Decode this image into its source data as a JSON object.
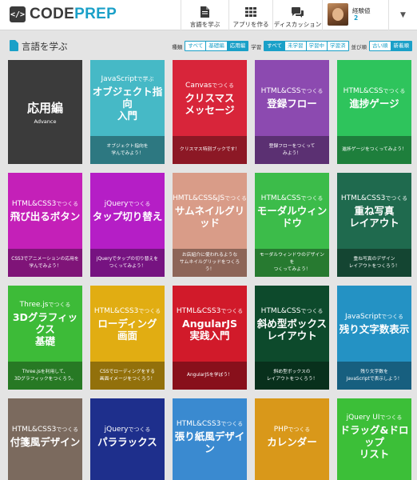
{
  "header": {
    "logo": {
      "icon": "code-icon",
      "glyph": "</>",
      "part1": "CODE",
      "part2": "PREP"
    },
    "nav": [
      {
        "label": "言語を学ぶ",
        "icon": "document-icon"
      },
      {
        "label": "アプリを作る",
        "icon": "grid-icon"
      },
      {
        "label": "ディスカッション",
        "icon": "chat-icon"
      }
    ],
    "user": {
      "name": "経験値",
      "level": "2",
      "caret": "▼"
    }
  },
  "page": {
    "title": "言語を学ぶ",
    "filters": {
      "kind_label": "種類",
      "kind_options": [
        "すべて",
        "基礎編",
        "応用編"
      ],
      "status_label": "学習",
      "status_options": [
        "すべて",
        "未学習",
        "学習中",
        "学習済"
      ],
      "sort_label": "並び順",
      "sort_options": [
        "古い順",
        "新着順"
      ]
    }
  },
  "colors": {
    "accent": "#1aa0c8"
  },
  "cards": [
    {
      "tech": "",
      "tech_suffix": "",
      "title": "応用編",
      "sub": "Advance",
      "desc": "",
      "color": "#3b3b3b"
    },
    {
      "tech": "JavaScript",
      "tech_suffix": "で学ぶ",
      "title": "オブジェクト指向\n入門",
      "sub": "",
      "desc": "オブジェクト指向を\n学んでみよう！",
      "color": "#46b9c6"
    },
    {
      "tech": "Canvas",
      "tech_suffix": "でつくる",
      "title": "クリスマス\nメッセージ",
      "sub": "",
      "desc": "クリスマス特別ブックです！",
      "color": "#d8253a"
    },
    {
      "tech": "HTML&CSS",
      "tech_suffix": "でつくる",
      "title": "登録フロー",
      "sub": "",
      "desc": "登録フローをつくって\nみよう！",
      "color": "#8c4ab0"
    },
    {
      "tech": "HTML&CSS",
      "tech_suffix": "でつくる",
      "title": "進捗ゲージ",
      "sub": "",
      "desc": "進捗ゲージをつくってみよう！",
      "color": "#2ec45c"
    },
    {
      "tech": "HTML&CSS3",
      "tech_suffix": "でつくる",
      "title": "飛び出るボタン",
      "sub": "",
      "desc": "CSS3でアニメーションの応用を\n学んでみよう！",
      "color": "#c420b8"
    },
    {
      "tech": "jQuery",
      "tech_suffix": "でつくる",
      "title": "タップ切り替え",
      "sub": "",
      "desc": "jQueryでタップの切り替えを\nつくってみよう！",
      "color": "#b51ec6"
    },
    {
      "tech": "HMTL&CSS&JS",
      "tech_suffix": "でつくる",
      "title": "サムネイルグリッド",
      "sub": "",
      "desc": "お店紹介に使われるような\nサムネイルグリッドをつくろう！",
      "color": "#d99c88"
    },
    {
      "tech": "HTML&CSS",
      "tech_suffix": "でつくる",
      "title": "モーダルウィンドウ",
      "sub": "",
      "desc": "モーダルウィンドウのデザインを\nつくってみよう！",
      "color": "#3cbc4a"
    },
    {
      "tech": "HTML&CSS3",
      "tech_suffix": "でつくる",
      "title": "重ね写真\nレイアウト",
      "sub": "",
      "desc": "重ね写真のデザイン\nレイアウトをつくろう！",
      "color": "#1f6a4e"
    },
    {
      "tech": "Three.js",
      "tech_suffix": "でつくる",
      "title": "3Dグラフィックス\n基礎",
      "sub": "",
      "desc": "Three.jsを利用して、\n3Dグラフィックをつくろう。",
      "color": "#3dbb38"
    },
    {
      "tech": "HTML&CSS3",
      "tech_suffix": "でつくる",
      "title": "ローディング\n画面",
      "sub": "",
      "desc": "CSSでローディングをする\n画面イメージをつくろう！",
      "color": "#e1ad12"
    },
    {
      "tech": "HTML&CSS3",
      "tech_suffix": "でつくる",
      "title": "AngularJS\n実践入門",
      "sub": "",
      "desc": "AngularJSを学ぼう！",
      "color": "#d11a2a"
    },
    {
      "tech": "HTML&CSS",
      "tech_suffix": "でつくる",
      "title": "斜め型ボックス\nレイアウト",
      "sub": "",
      "desc": "斜め型ボックスの\nレイアウトをつくろう！",
      "color": "#0d4a2c"
    },
    {
      "tech": "JavaScript",
      "tech_suffix": "でつくる",
      "title": "残り文字数表示",
      "sub": "",
      "desc": "残り文字数を\nJavaScriptで表示しよう！",
      "color": "#2492c4"
    },
    {
      "tech": "HTML&CSS3",
      "tech_suffix": "でつくる",
      "title": "付箋風デザイン",
      "sub": "",
      "desc": "",
      "color": "#7b6a5e"
    },
    {
      "tech": "jQuery",
      "tech_suffix": "でつくる",
      "title": "パララックス",
      "sub": "",
      "desc": "",
      "color": "#1e2f8c"
    },
    {
      "tech": "HTML&CSS3",
      "tech_suffix": "でつくる",
      "title": "張り紙風デザイン",
      "sub": "",
      "desc": "",
      "color": "#3a8ad0"
    },
    {
      "tech": "PHP",
      "tech_suffix": "でつくる",
      "title": "カレンダー",
      "sub": "",
      "desc": "",
      "color": "#d9981a"
    },
    {
      "tech": "jQuery UI",
      "tech_suffix": "でつくる",
      "title": "ドラッグ&ドロップ\nリスト",
      "sub": "",
      "desc": "",
      "color": "#3cbf38"
    }
  ]
}
